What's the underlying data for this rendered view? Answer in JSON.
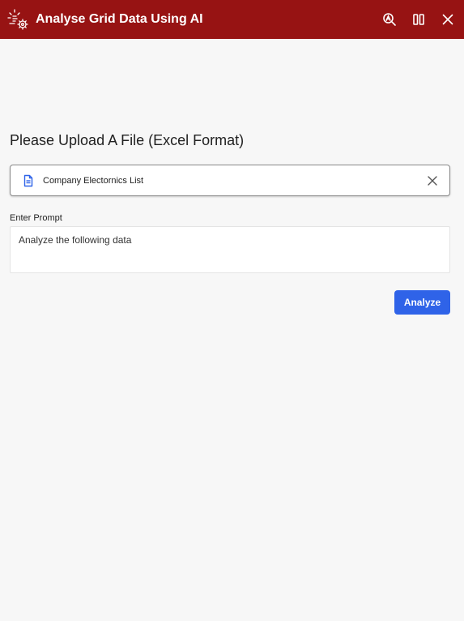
{
  "window": {
    "title": "Analyse Grid Data Using AI",
    "icons": {
      "app": "ai-analytics-icon",
      "zoom": "zoom-ai-icon",
      "columns": "columns-icon",
      "close": "close-icon"
    }
  },
  "upload": {
    "heading": "Please Upload A File (Excel Format)",
    "file_name": "Company Electornics List",
    "file_icon": "document-icon",
    "clear_icon": "close-icon"
  },
  "prompt": {
    "label": "Enter Prompt",
    "value": "Analyze the following data"
  },
  "actions": {
    "analyze_label": "Analyze"
  },
  "colors": {
    "titlebar": "#971313",
    "accent": "#2f63e8",
    "background": "#f7f7f7"
  }
}
